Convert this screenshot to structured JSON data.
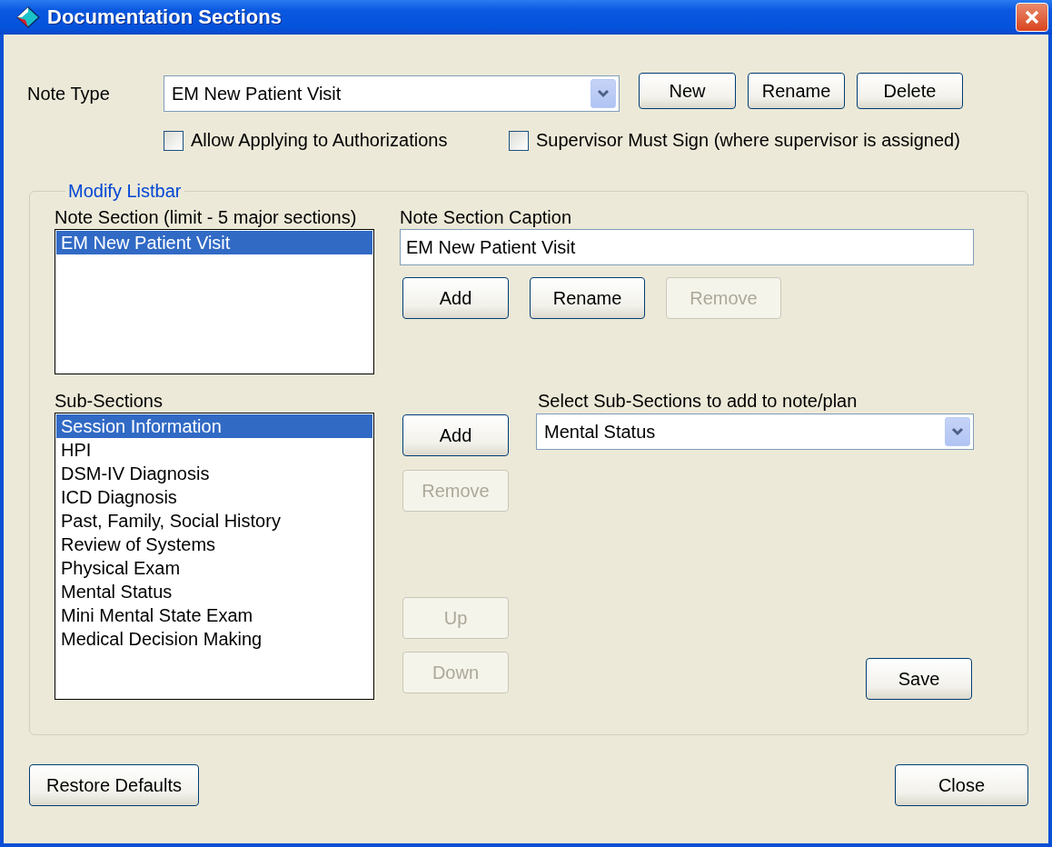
{
  "window": {
    "title": "Documentation Sections"
  },
  "note_type": {
    "label": "Note Type",
    "value": "EM New Patient Visit"
  },
  "top_buttons": [
    {
      "label": "New",
      "disabled": false
    },
    {
      "label": "Rename",
      "disabled": false
    },
    {
      "label": "Delete",
      "disabled": false
    }
  ],
  "checkboxes": [
    {
      "label": "Allow Applying to Authorizations",
      "checked": false
    },
    {
      "label": "Supervisor Must Sign (where supervisor is assigned)",
      "checked": false
    }
  ],
  "modify_listbar": {
    "title": "Modify Listbar",
    "note_section": {
      "label": "Note Section (limit - 5 major sections)",
      "items": [
        {
          "label": "EM New Patient Visit",
          "selected": true
        }
      ]
    },
    "caption": {
      "label": "Note Section Caption",
      "value": "EM New Patient Visit"
    },
    "section_buttons": [
      {
        "label": "Add",
        "disabled": false
      },
      {
        "label": "Rename",
        "disabled": false
      },
      {
        "label": "Remove",
        "disabled": true
      }
    ],
    "sub_sections": {
      "label": "Sub-Sections",
      "items": [
        {
          "label": "Session Information",
          "selected": true
        },
        {
          "label": "HPI",
          "selected": false
        },
        {
          "label": "DSM-IV Diagnosis",
          "selected": false
        },
        {
          "label": "ICD Diagnosis",
          "selected": false
        },
        {
          "label": "Past, Family, Social History",
          "selected": false
        },
        {
          "label": "Review of Systems",
          "selected": false
        },
        {
          "label": "Physical Exam",
          "selected": false
        },
        {
          "label": "Mental Status",
          "selected": false
        },
        {
          "label": "Mini Mental State Exam",
          "selected": false
        },
        {
          "label": "Medical Decision Making",
          "selected": false
        }
      ]
    },
    "sub_buttons": [
      {
        "label": "Add",
        "disabled": false
      },
      {
        "label": "Remove",
        "disabled": true
      }
    ],
    "order_buttons": [
      {
        "label": "Up",
        "disabled": true
      },
      {
        "label": "Down",
        "disabled": true
      }
    ],
    "select_sub": {
      "label": "Select Sub-Sections to add to note/plan",
      "value": "Mental Status"
    },
    "save_button": {
      "label": "Save",
      "disabled": false
    }
  },
  "footer_buttons": [
    {
      "label": "Restore Defaults",
      "disabled": false
    },
    {
      "label": "Close",
      "disabled": false
    }
  ]
}
